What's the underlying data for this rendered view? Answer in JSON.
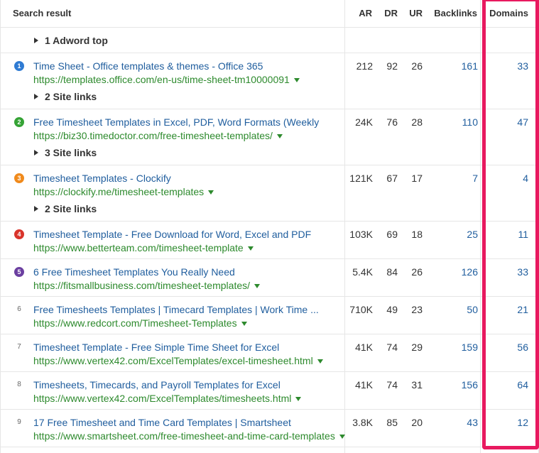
{
  "header": {
    "search_result": "Search result",
    "ar": "AR",
    "dr": "DR",
    "ur": "UR",
    "backlinks": "Backlinks",
    "domains": "Domains"
  },
  "adword": "1 Adword top",
  "rows": [
    {
      "rank": "1",
      "badge_color": "#2f7bd3",
      "title": "Time Sheet - Office templates & themes - Office 365",
      "url": "https://templates.office.com/en-us/time-sheet-tm10000091",
      "ar": "212",
      "dr": "92",
      "ur": "26",
      "backlinks": "161",
      "domains": "33",
      "sitelinks": "2 Site links"
    },
    {
      "rank": "2",
      "badge_color": "#35a335",
      "title": "Free Timesheet Templates in Excel, PDF, Word Formats (Weekly",
      "url": "https://biz30.timedoctor.com/free-timesheet-templates/",
      "ar": "24K",
      "dr": "76",
      "ur": "28",
      "backlinks": "110",
      "domains": "47",
      "sitelinks": "3 Site links"
    },
    {
      "rank": "3",
      "badge_color": "#f08a1c",
      "title": "Timesheet Templates - Clockify",
      "url": "https://clockify.me/timesheet-templates",
      "ar": "121K",
      "dr": "67",
      "ur": "17",
      "backlinks": "7",
      "domains": "4",
      "sitelinks": "2 Site links"
    },
    {
      "rank": "4",
      "badge_color": "#d9342b",
      "title": "Timesheet Template - Free Download for Word, Excel and PDF",
      "url": "https://www.betterteam.com/timesheet-template",
      "ar": "103K",
      "dr": "69",
      "ur": "18",
      "backlinks": "25",
      "domains": "11"
    },
    {
      "rank": "5",
      "badge_color": "#6b3fa0",
      "title": "6 Free Timesheet Templates You Really Need",
      "url": "https://fitsmallbusiness.com/timesheet-templates/",
      "ar": "5.4K",
      "dr": "84",
      "ur": "26",
      "backlinks": "126",
      "domains": "33"
    },
    {
      "rank": "6",
      "title": "Free Timesheets Templates | Timecard Templates | Work Time ...",
      "url": "https://www.redcort.com/Timesheet-Templates",
      "ar": "710K",
      "dr": "49",
      "ur": "23",
      "backlinks": "50",
      "domains": "21"
    },
    {
      "rank": "7",
      "title": "Timesheet Template - Free Simple Time Sheet for Excel",
      "url": "https://www.vertex42.com/ExcelTemplates/excel-timesheet.html",
      "ar": "41K",
      "dr": "74",
      "ur": "29",
      "backlinks": "159",
      "domains": "56"
    },
    {
      "rank": "8",
      "title": "Timesheets, Timecards, and Payroll Templates for Excel",
      "url": "https://www.vertex42.com/ExcelTemplates/timesheets.html",
      "ar": "41K",
      "dr": "74",
      "ur": "31",
      "backlinks": "156",
      "domains": "64"
    },
    {
      "rank": "9",
      "title": "17 Free Timesheet and Time Card Templates | Smartsheet",
      "url": "https://www.smartsheet.com/free-timesheet-and-time-card-templates",
      "ar": "3.8K",
      "dr": "85",
      "ur": "20",
      "backlinks": "43",
      "domains": "12"
    }
  ],
  "highlight_color": "#e8195f"
}
